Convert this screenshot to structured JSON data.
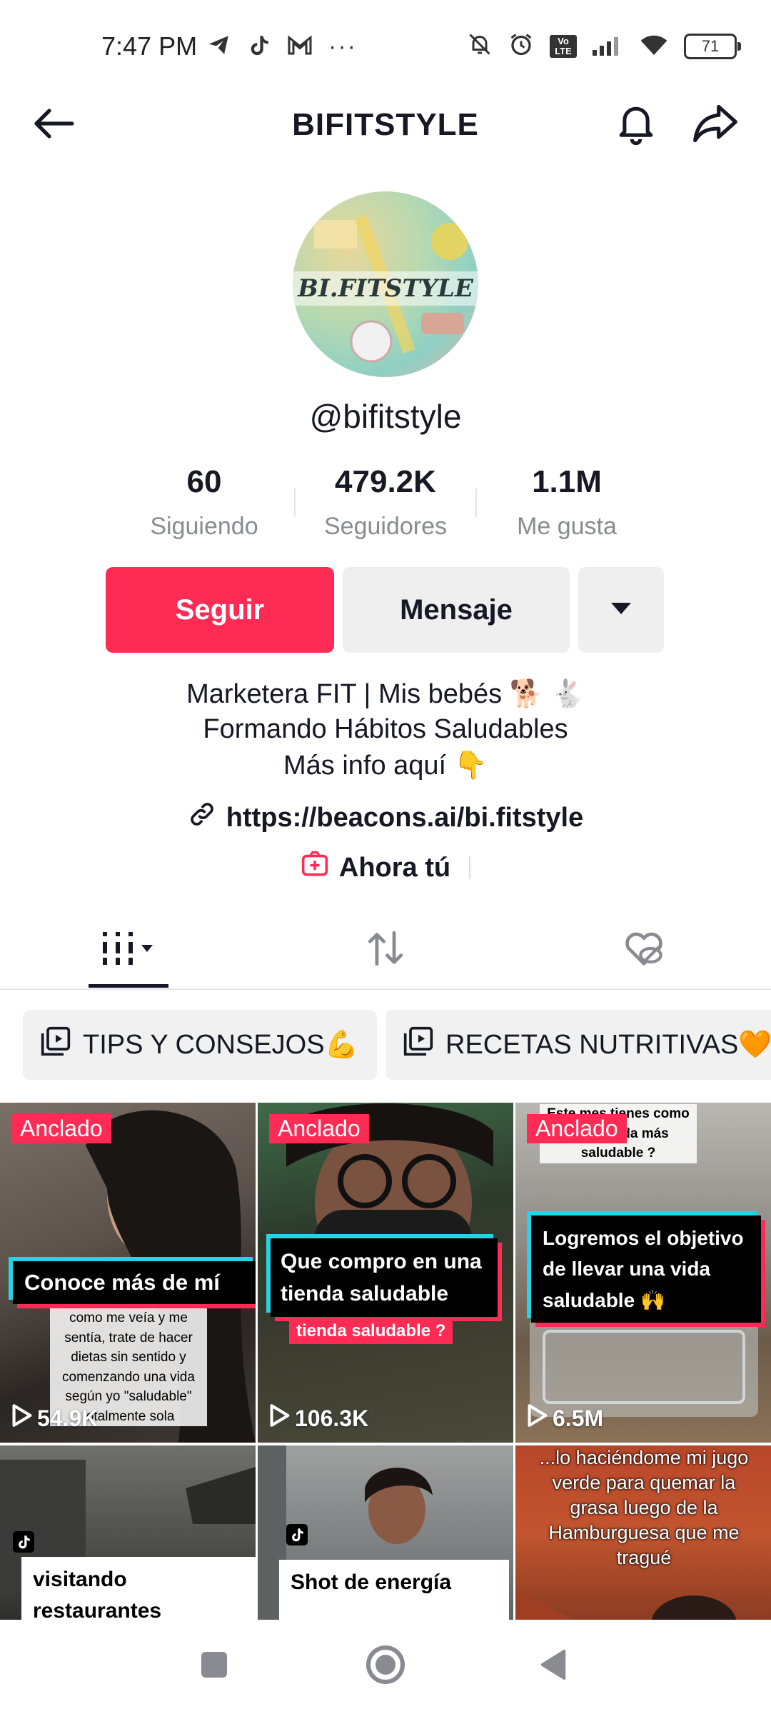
{
  "status_bar": {
    "time": "7:47 PM",
    "more": "···",
    "battery": "71",
    "volte": "Vo LTE"
  },
  "header": {
    "title": "BIFITSTYLE"
  },
  "profile": {
    "avatar_text": "BI.FITSTYLE",
    "username": "@bifitstyle",
    "stats": [
      {
        "value": "60",
        "label": "Siguiendo"
      },
      {
        "value": "479.2K",
        "label": "Seguidores"
      },
      {
        "value": "1.1M",
        "label": "Me gusta"
      }
    ],
    "follow_label": "Seguir",
    "message_label": "Mensaje",
    "bio": [
      "Marketera FIT | Mis bebés 🐕 🐇",
      "Formando Hábitos Saludables",
      "Más info aquí 👇"
    ],
    "link": "https://beacons.ai/bi.fitstyle",
    "ahora_label": "Ahora tú"
  },
  "playlists": [
    {
      "label": "TIPS Y CONSEJOS💪"
    },
    {
      "label": "RECETAS NUTRITIVAS🧡"
    }
  ],
  "videos": [
    {
      "pinned": "Anclado",
      "views": "54.9K",
      "overlay": "Conoce más de mí",
      "subtext": "como me veía y me sentía, trate de hacer dietas sin sentido y comenzando una vida según yo \"saludable\" totalmente sola"
    },
    {
      "pinned": "Anclado",
      "views": "106.3K",
      "overlay": "Que compro en una tienda saludable",
      "subtext": "tienda saludable ?"
    },
    {
      "pinned": "Anclado",
      "views": "6.5M",
      "overlay": "Logremos el objetivo de llevar una vida saludable 🙌",
      "subtext": "Este mes tienes como ... una vida más saludable ?"
    },
    {
      "caption": "visitando restaurantes"
    },
    {
      "caption": "Shot de energía"
    },
    {
      "caption": "...lo haciéndome mi jugo verde para quemar la grasa luego de la Hamburguesa que me tragué"
    }
  ],
  "colors": {
    "accent": "#fe2c55",
    "cyan": "#25d3e8",
    "button_grey": "#efeff0"
  }
}
